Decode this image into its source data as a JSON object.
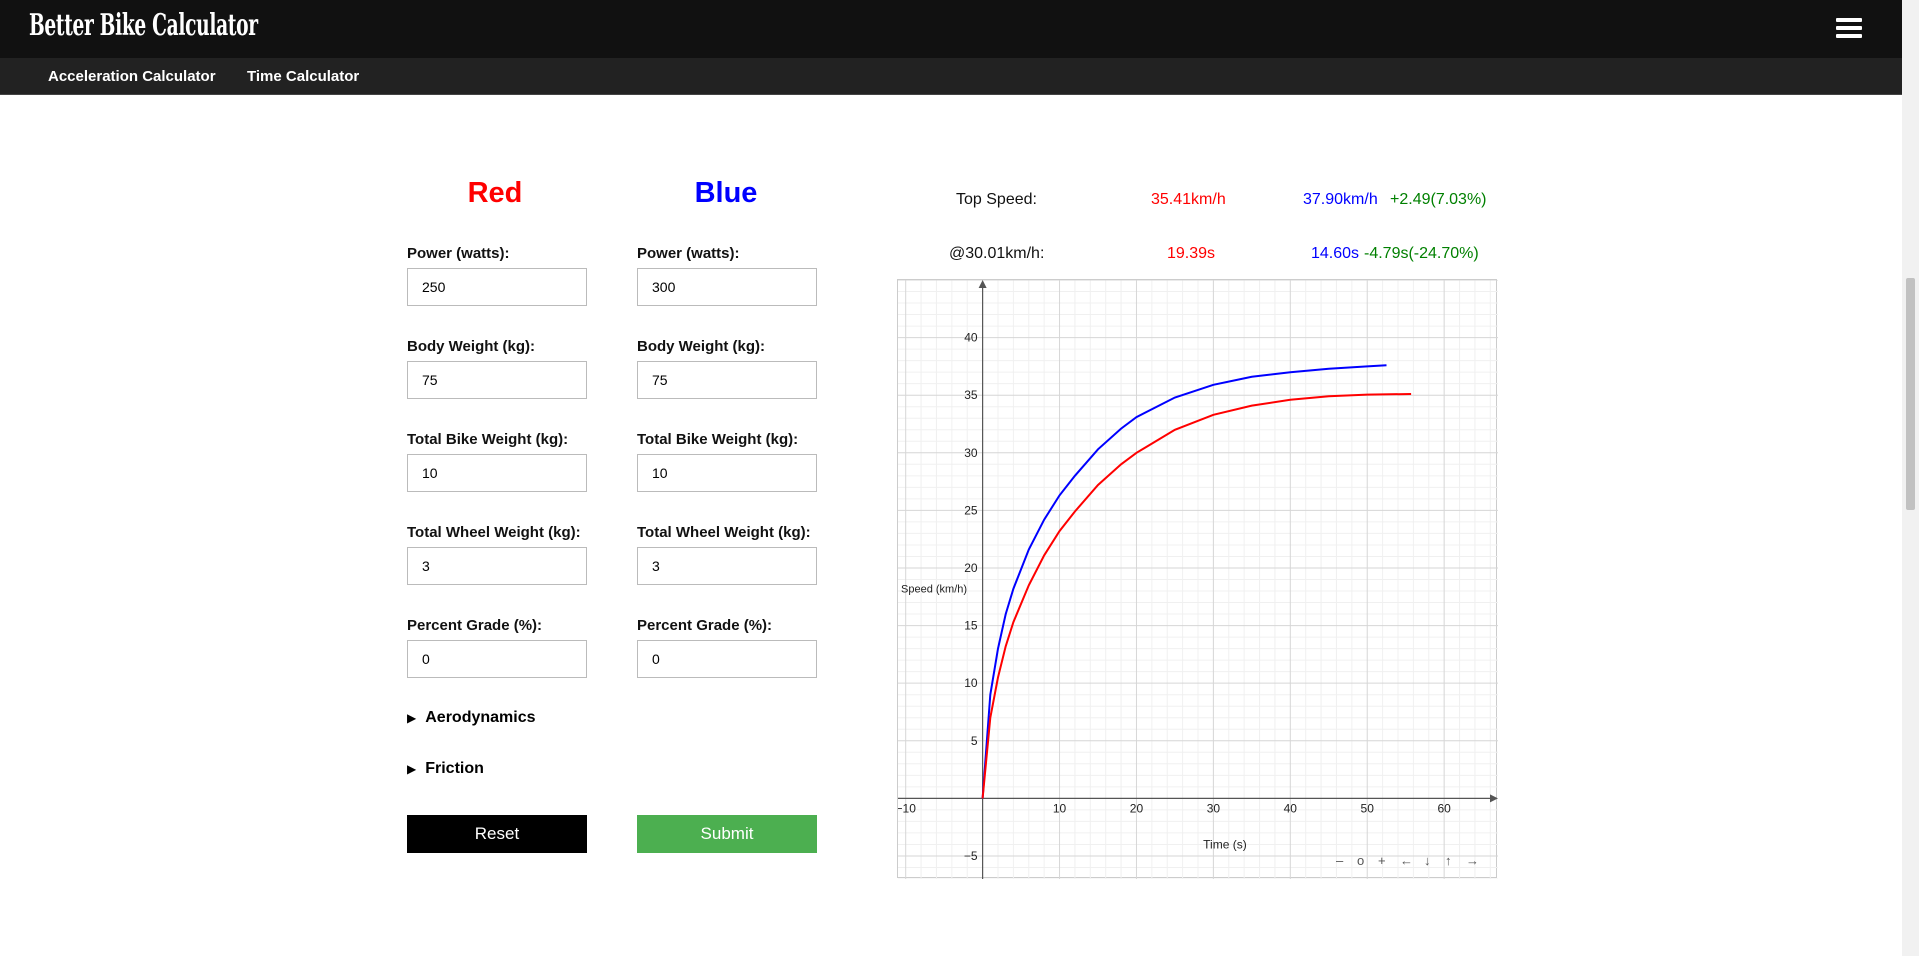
{
  "header": {
    "title": "Better Bike Calculator",
    "menu_icon": "hamburger-icon"
  },
  "nav": {
    "items": [
      "Acceleration Calculator",
      "Time Calculator"
    ]
  },
  "red": {
    "heading": "Red",
    "color": "#ff0000",
    "power_label": "Power (watts):",
    "power_value": "250",
    "body_label": "Body Weight (kg):",
    "body_value": "75",
    "bike_label": "Total Bike Weight (kg):",
    "bike_value": "10",
    "wheel_label": "Total Wheel Weight (kg):",
    "wheel_value": "3",
    "grade_label": "Percent Grade (%):",
    "grade_value": "0"
  },
  "blue": {
    "heading": "Blue",
    "color": "#0000ff",
    "power_label": "Power (watts):",
    "power_value": "300",
    "body_label": "Body Weight (kg):",
    "body_value": "75",
    "bike_label": "Total Bike Weight (kg):",
    "bike_value": "10",
    "wheel_label": "Total Wheel Weight (kg):",
    "wheel_value": "3",
    "grade_label": "Percent Grade (%):",
    "grade_value": "0"
  },
  "sections": {
    "aero": "Aerodynamics",
    "friction": "Friction"
  },
  "buttons": {
    "reset": "Reset",
    "submit": "Submit",
    "submit_color": "#4caf50"
  },
  "results": {
    "top_speed_label": "Top Speed:",
    "top_speed_red": "35.41km/h",
    "top_speed_blue": "37.90km/h",
    "top_speed_diff": "+2.49(7.03%)",
    "time_label": "@30.01km/h:",
    "time_red": "19.39s",
    "time_blue": "14.60s",
    "time_diff": "-4.79s(-24.70%)",
    "diff_color": "#008000"
  },
  "graph_controls": [
    "–",
    "o",
    "+",
    "←",
    "↓",
    "↑",
    "→"
  ],
  "chart_data": {
    "type": "line",
    "xlabel": "Time (s)",
    "ylabel": "Speed (km/h)",
    "xlim": [
      -11,
      67
    ],
    "ylim": [
      -7,
      45
    ],
    "x_ticks": [
      -10,
      10,
      20,
      30,
      40,
      50,
      60
    ],
    "y_ticks": [
      -5,
      5,
      10,
      15,
      20,
      25,
      30,
      35,
      40
    ],
    "grid": true,
    "series": [
      {
        "color": "#0000ff",
        "x": [
          0,
          1,
          2,
          3,
          4,
          6,
          8,
          10,
          12,
          15,
          18,
          20,
          25,
          30,
          35,
          40,
          45,
          50,
          52.5
        ],
        "y": [
          0,
          9,
          13,
          16,
          18.2,
          21.6,
          24.2,
          26.3,
          28,
          30.3,
          32.1,
          33.1,
          34.8,
          35.9,
          36.6,
          37,
          37.3,
          37.5,
          37.6
        ]
      },
      {
        "color": "#ff0000",
        "x": [
          0,
          1,
          2,
          3,
          4,
          6,
          8,
          10,
          12,
          15,
          18,
          20,
          25,
          30,
          35,
          40,
          45,
          50,
          55.7
        ],
        "y": [
          0,
          7,
          10.5,
          13.2,
          15.3,
          18.5,
          21.1,
          23.2,
          24.9,
          27.2,
          29,
          30,
          32,
          33.3,
          34.1,
          34.6,
          34.9,
          35.05,
          35.1
        ]
      }
    ]
  }
}
